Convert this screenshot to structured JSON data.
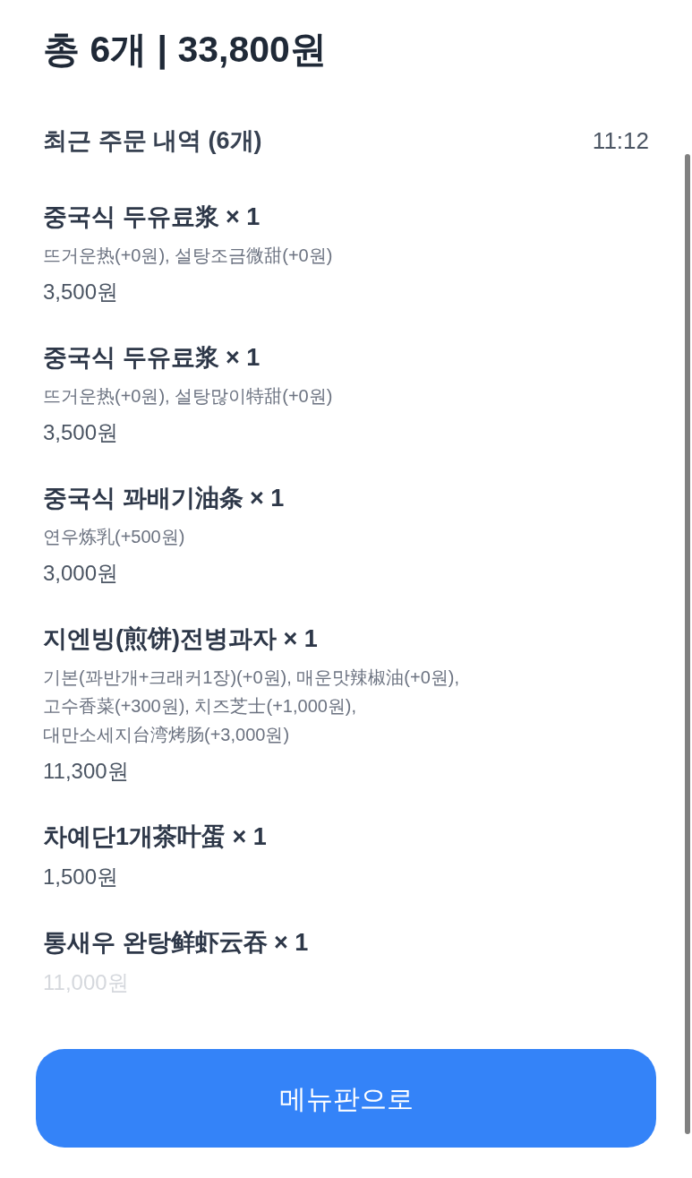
{
  "header": {
    "title": "총 6개 | 33,800원"
  },
  "recent_orders": {
    "title": "최근 주문 내역 (6개)",
    "time": "11:12",
    "items": [
      {
        "name": "중국식 두유료浆 × 1",
        "options": "뜨거운热(+0원), 설탕조금微甜(+0원)",
        "price": "3,500원"
      },
      {
        "name": "중국식 두유료浆 × 1",
        "options": "뜨거운热(+0원), 설탕많이特甜(+0원)",
        "price": "3,500원"
      },
      {
        "name": "중국식 꽈배기油条 × 1",
        "options": "연우炼乳(+500원)",
        "price": "3,000원"
      },
      {
        "name": "지엔빙(煎饼)전병과자 × 1",
        "options": "기본(꽈반개+크래커1장)(+0원), 매운맛辣椒油(+0원), 고수香菜(+300원), 치즈芝士(+1,000원), 대만소세지台湾烤肠(+3,000원)",
        "price": "11,300원"
      },
      {
        "name": "차예단1개茶叶蛋 × 1",
        "price": "1,500원"
      },
      {
        "name": "통새우 완탕鲜虾云吞 × 1",
        "price": "11,000원"
      }
    ]
  },
  "button": {
    "label": "메뉴판으로"
  }
}
